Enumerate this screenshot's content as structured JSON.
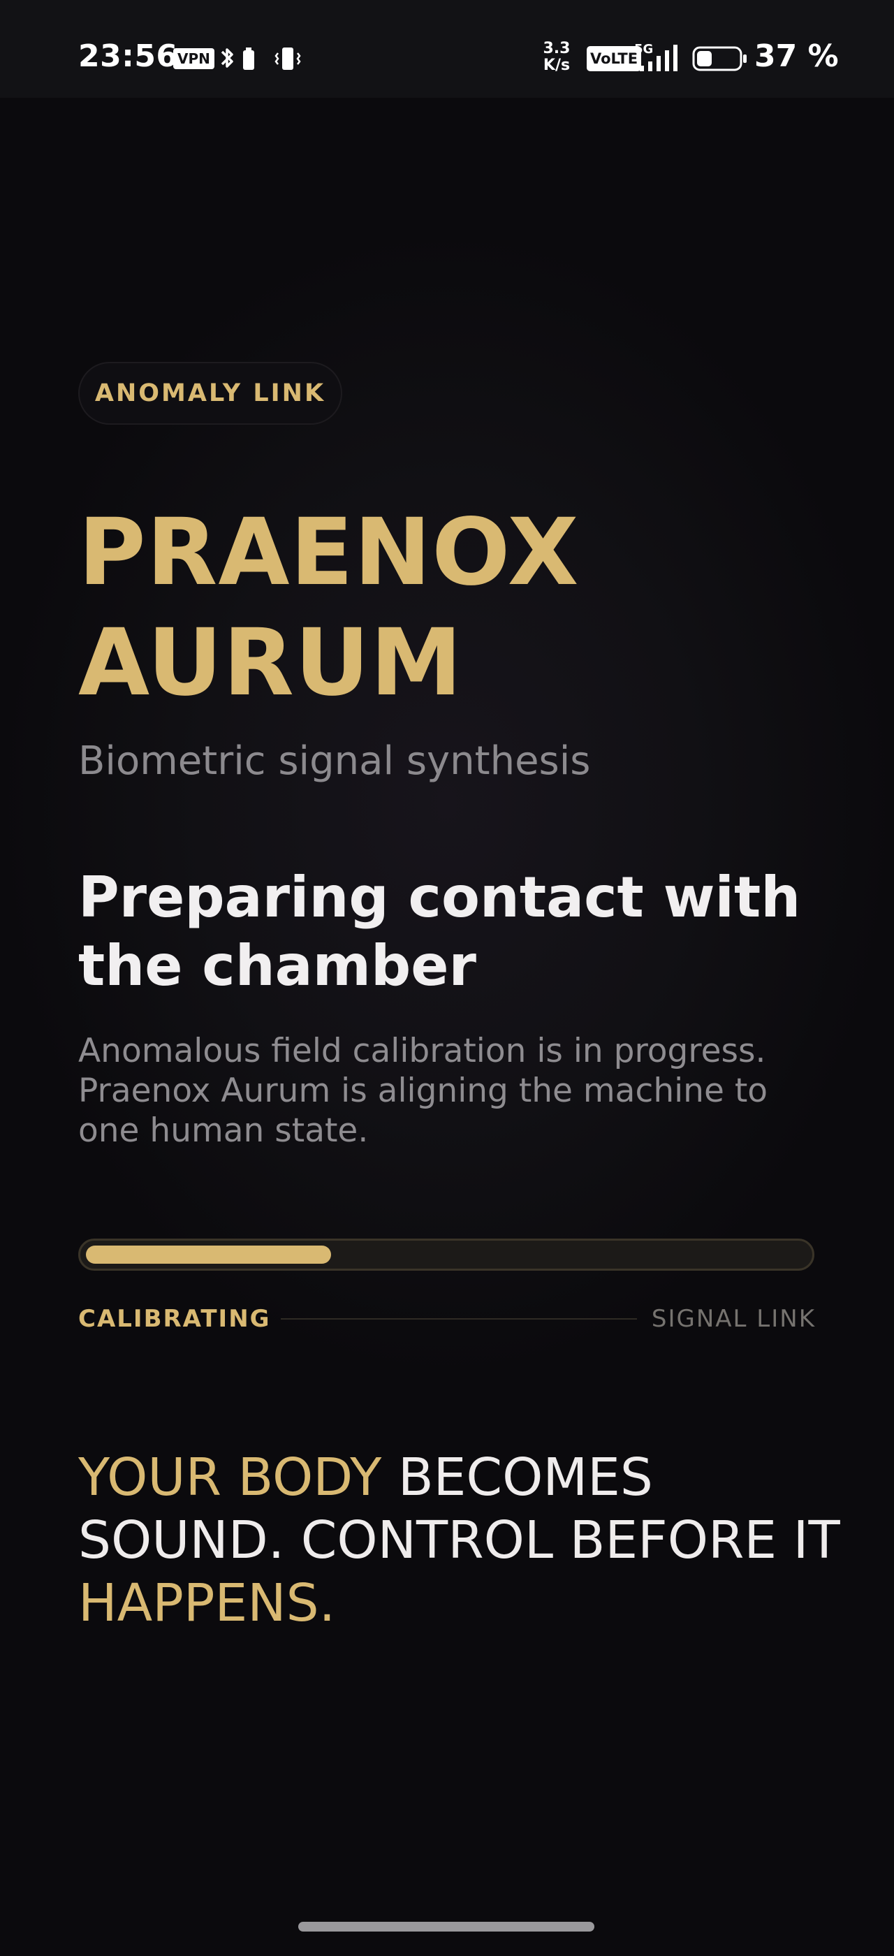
{
  "status_bar": {
    "time": "23:56",
    "vpn": "VPN",
    "speed_value": "3.3",
    "speed_unit": "K/s",
    "volte": "VoLTE",
    "network": "5G",
    "battery": "37 %",
    "battery_level": 0.37,
    "icons": [
      "bluetooth-icon",
      "battery-small-icon",
      "vibrate-icon",
      "signal-icon",
      "battery-icon"
    ]
  },
  "main": {
    "badge": "ANOMALY LINK",
    "title": "PRAENOX AURUM",
    "subtitle": "Biometric signal synthesis",
    "heading": "Preparing contact with the chamber",
    "description": "Anomalous field calibration is in progress. Praenox Aurum is aligning the machine to one human state.",
    "progress": {
      "value": 0.34,
      "left_label": "CALIBRATING",
      "right_label": "SIGNAL LINK"
    },
    "tagline": {
      "part1": "YOUR BODY",
      "part2": " BECOMES SOUND. CONTROL BEFORE IT ",
      "part3": "HAPPENS."
    }
  },
  "colors": {
    "accent_gold": "#d9b972",
    "background": "#0b0a0d",
    "text_primary": "#f1eff0",
    "text_secondary": "#8e8c90"
  }
}
